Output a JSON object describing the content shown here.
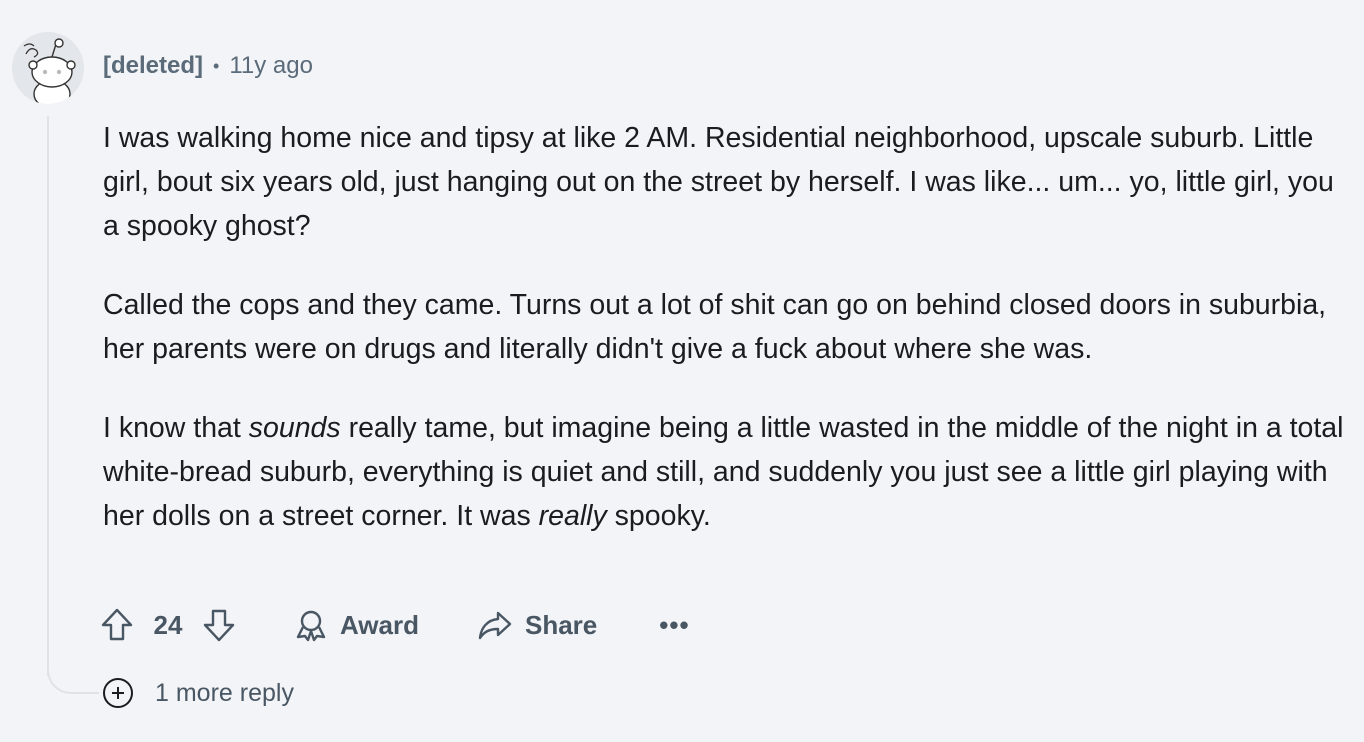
{
  "comment": {
    "author": "[deleted]",
    "separator": "•",
    "age": "11y ago",
    "paragraphs": [
      [
        "I was walking home nice and tipsy at like 2 AM. Residential neighborhood, upscale suburb. Little girl, bout six years old, just hanging out on the street by herself. I was like... um... yo, little girl, you a spooky ghost?"
      ],
      [
        "Called the cops and they came. Turns out a lot of shit can go on behind closed doors in suburbia, her parents were on drugs and literally didn't give a fuck about where she was."
      ]
    ],
    "paragraph3": {
      "part1": "I know that ",
      "em1": "sounds",
      "part2": " really tame, but imagine being a little wasted in the middle of the night in a total white-bread suburb, everything is quiet and still, and suddenly you just see a little girl playing with her dolls on a street corner. It was ",
      "em2": "really",
      "part3": " spooky."
    }
  },
  "actions": {
    "upvote_icon": "upvote-arrow-icon",
    "score": "24",
    "downvote_icon": "downvote-arrow-icon",
    "award_icon": "award-ribbon-icon",
    "award_label": "Award",
    "share_icon": "share-arrow-icon",
    "share_label": "Share",
    "more_label": "•••"
  },
  "replies": {
    "icon": "plus-circle-icon",
    "label": "1 more reply"
  },
  "colors": {
    "background": "#f2f4f7",
    "text": "#1a1c1e",
    "meta": "#5b6b7a",
    "action": "#495663",
    "thread_line": "#dfe3e8"
  }
}
